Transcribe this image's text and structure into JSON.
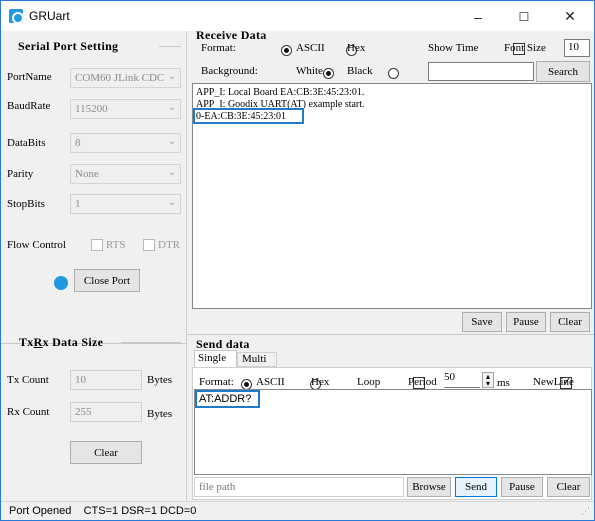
{
  "window": {
    "title": "GRUart",
    "minimize": "–",
    "maximize": "☐",
    "close": "✕"
  },
  "serial": {
    "group_title": "Serial Port Setting",
    "port_label": "PortName",
    "port_value": "COM60 JLink CDC",
    "baud_label": "BaudRate",
    "baud_value": "115200",
    "databits_label": "DataBits",
    "databits_value": "8",
    "parity_label": "Parity",
    "parity_value": "None",
    "stopbits_label": "StopBits",
    "stopbits_value": "1",
    "flow_label": "Flow Control",
    "rts_label": "RTS",
    "dtr_label": "DTR",
    "close_port_label": "Close Port",
    "indicator_color": "#1e9be0"
  },
  "txrx": {
    "group_title_pre": "Tx",
    "group_title_r": "R",
    "group_title_post": "x Data Size",
    "tx_label": "Tx Count",
    "tx_value": "10",
    "tx_unit": "Bytes",
    "rx_label": "Rx Count",
    "rx_value": "255",
    "rx_unit": "Bytes",
    "clear_label": "Clear"
  },
  "receive": {
    "group_title": "Receive Data",
    "format_label": "Format:",
    "ascii_label": "ASCII",
    "hex_label": "Hex",
    "show_time_label": "Show Time",
    "font_size_label": "Font Size",
    "font_size_value": "10",
    "background_label": "Background:",
    "white_label": "White",
    "black_label": "Black",
    "search_value": "",
    "search_label": "Search",
    "lines": [
      "APP_I: Local Board EA:CB:3E:45:23:01.",
      "APP_I: Goodix UART(AT) example start.",
      "0-EA:CB:3E:45:23:01"
    ],
    "save_label": "Save",
    "pause_label": "Pause",
    "clear_label": "Clear"
  },
  "send": {
    "group_title": "Send data",
    "tab_single": "Single",
    "tab_multi": "Multi",
    "format_label": "Format:",
    "ascii_label": "ASCII",
    "hex_label": "Hex",
    "loop_label": "Loop",
    "period_label": "Period",
    "period_value": "50",
    "period_unit": "ms",
    "newline_label": "NewLine",
    "text": "AT:ADDR?",
    "file_path_placeholder": "file path",
    "browse_label": "Browse",
    "send_label": "Send",
    "pause_label": "Pause",
    "clear_label": "Clear"
  },
  "status": {
    "text": "Port Opened    CTS=1 DSR=1 DCD=0"
  }
}
